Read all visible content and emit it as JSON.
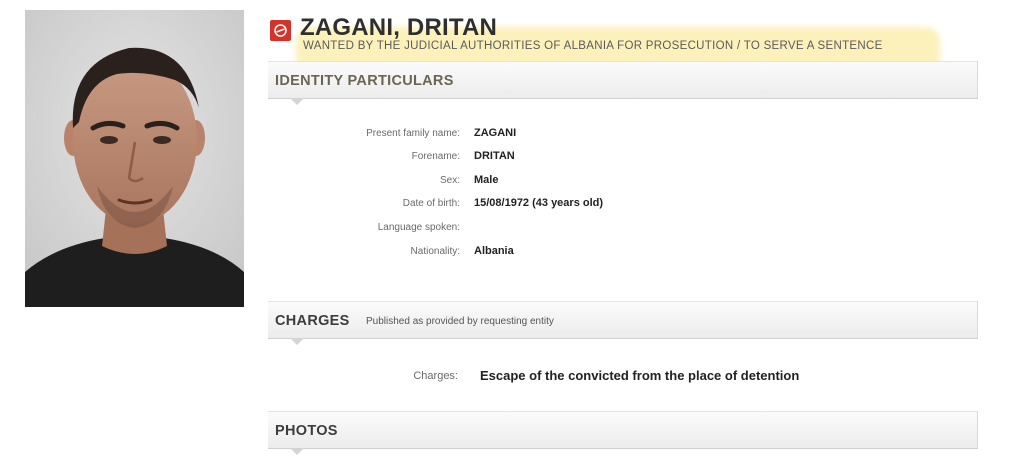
{
  "header": {
    "name": "ZAGANI, DRITAN",
    "subtitle": "WANTED BY THE JUDICIAL AUTHORITIES OF ALBANIA FOR PROSECUTION / TO SERVE A SENTENCE",
    "icon": "red-notice-icon"
  },
  "identity": {
    "title": "IDENTITY PARTICULARS",
    "fields": [
      {
        "label": "Present family name:",
        "value": "ZAGANI"
      },
      {
        "label": "Forename:",
        "value": "DRITAN"
      },
      {
        "label": "Sex:",
        "value": "Male"
      },
      {
        "label": "Date of birth:",
        "value": "15/08/1972 (43 years old)"
      },
      {
        "label": "Language spoken:",
        "value": ""
      },
      {
        "label": "Nationality:",
        "value": "Albania"
      }
    ]
  },
  "charges": {
    "title": "CHARGES",
    "note": "Published as provided by requesting entity",
    "label": "Charges:",
    "value": "Escape of the convicted from the place of detention"
  },
  "photos": {
    "title": "PHOTOS"
  },
  "colors": {
    "accent_red": "#d3332a",
    "highlight": "#f6df7a"
  }
}
